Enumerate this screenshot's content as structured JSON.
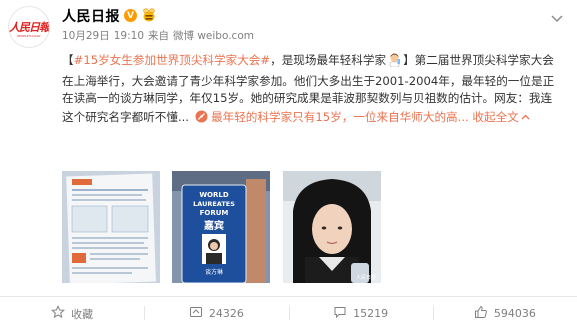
{
  "header": {
    "account_name": "人民日报",
    "verified_badge": "V",
    "avatar_logo_text": "人民日報",
    "avatar_logo_sub": "PEOPLE'S DAILY",
    "date": "10月29日",
    "time": "19:10",
    "source_prefix": "来自",
    "source": "微博 weibo.com"
  },
  "post": {
    "open_bracket": "【",
    "hashtag": "#15岁女生参加世界顶尖科学家大会#",
    "title_rest": "，是现场最年轻科学家",
    "close_bracket": "】",
    "body": "第二届世界顶尖科学家大会在上海举行，大会邀请了青少年科学家参加。他们大多出生于2001-2004年，最年轻的一位是正在读高一的谈方琳同学，年仅15岁。她的研究成果是菲波那契数列与贝祖数的估计。网友：我连这个研究名字都听不懂...",
    "link_text": "最年轻的科学家只有15岁，一位来自华师大的高...",
    "collapse": "收起全文"
  },
  "images": {
    "badge_line1": "WORLD",
    "badge_line2": "LAUREATES",
    "badge_line3": "FORUM",
    "badge_guest": "嘉宾",
    "badge_name": "谈方琳",
    "watermark": "人民日报"
  },
  "actions": {
    "favorite": "收藏",
    "repost_count": "24326",
    "comment_count": "15219",
    "like_count": "594036"
  },
  "colors": {
    "link": "#eb7350",
    "badge": "#ff9a00",
    "muted": "#808080",
    "brand_red": "#e0201e"
  }
}
